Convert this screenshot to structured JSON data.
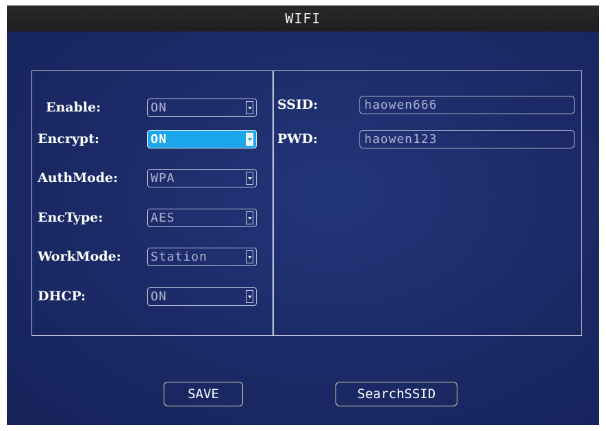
{
  "window": {
    "title": "WIFI"
  },
  "settings": [
    {
      "label": "Enable:",
      "value": "ON"
    },
    {
      "label": "Encrypt:",
      "value": "ON"
    },
    {
      "label": "AuthMode:",
      "value": "WPA"
    },
    {
      "label": "EncType:",
      "value": "AES"
    },
    {
      "label": "WorkMode:",
      "value": "Station"
    },
    {
      "label": "DHCP:",
      "value": "ON"
    }
  ],
  "network": {
    "ssid_label": "SSID:",
    "ssid_value": "haowen666",
    "pwd_label": "PWD:",
    "pwd_value": "haowen123"
  },
  "buttons": {
    "save": "SAVE",
    "search": "SearchSSID"
  },
  "colors": {
    "background": "#1c2b6a",
    "focus": "#1aa6e8",
    "titlebar": "#252527"
  }
}
